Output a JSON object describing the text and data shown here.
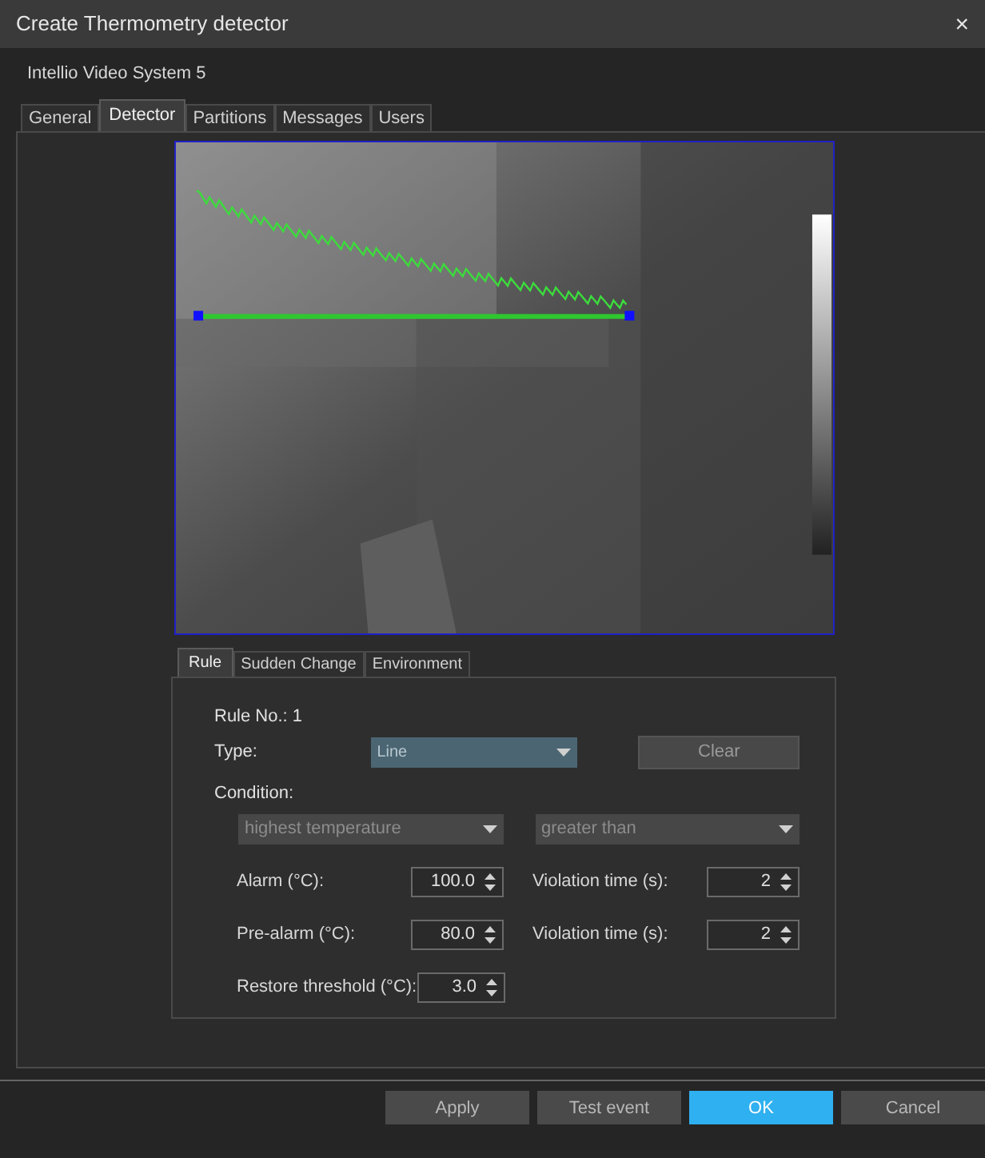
{
  "window": {
    "title": "Create Thermometry detector",
    "close": "×"
  },
  "system": "Intellio Video System 5",
  "tabs": [
    {
      "label": "General",
      "selected": false
    },
    {
      "label": "Detector",
      "selected": true
    },
    {
      "label": "Partitions",
      "selected": false
    },
    {
      "label": "Messages",
      "selected": false
    },
    {
      "label": "Users",
      "selected": false
    }
  ],
  "rule_tabs": [
    {
      "label": "Rule",
      "selected": true
    },
    {
      "label": "Sudden Change",
      "selected": false
    },
    {
      "label": "Environment",
      "selected": false
    }
  ],
  "rule": {
    "rule_no": "Rule No.: 1",
    "type_label": "Type:",
    "type_value": "Line",
    "clear": "Clear",
    "condition_label": "Condition:",
    "conditions": [
      {
        "value": "highest temperature",
        "disabled": true
      },
      {
        "value": "greater than",
        "disabled": true
      }
    ],
    "spin_rows": [
      [
        {
          "label": "Alarm (°C):",
          "value": "100.0"
        },
        {
          "label": "Violation time (s):",
          "value": "2"
        }
      ],
      [
        {
          "label": "Pre-alarm (°C):",
          "value": "80.0"
        },
        {
          "label": "Violation time (s):",
          "value": "2"
        }
      ],
      [
        {
          "label": "Restore threshold (°C):",
          "value": "3.0"
        }
      ]
    ]
  },
  "buttons": [
    {
      "label": "Apply",
      "primary": false
    },
    {
      "label": "Test event",
      "primary": false
    },
    {
      "label": "OK",
      "primary": true
    },
    {
      "label": "Cancel",
      "primary": false
    }
  ]
}
